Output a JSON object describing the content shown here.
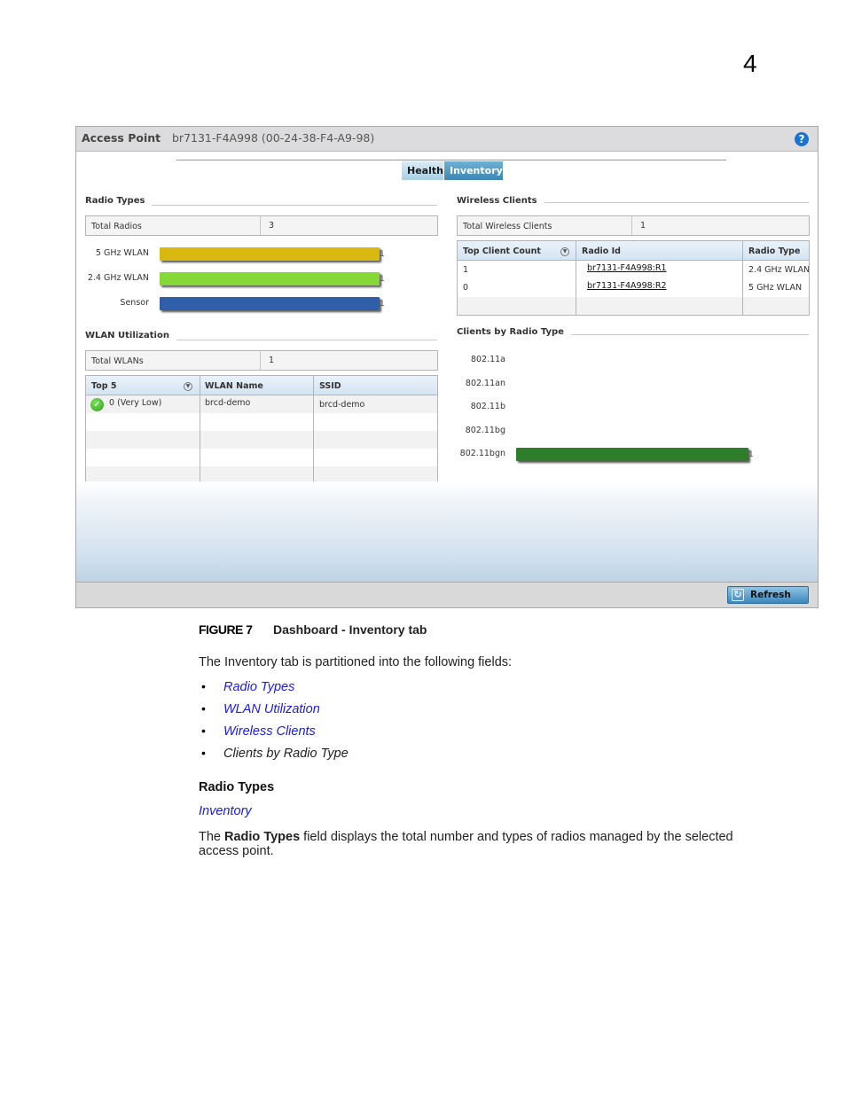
{
  "page": {
    "chapter_number": "4"
  },
  "panel": {
    "header_label": "Access Point",
    "device_name": "br7131-F4A998 (00-24-38-F4-A9-98)",
    "help_icon": "question-circle-icon",
    "tabs": [
      {
        "label": "Health",
        "active": false
      },
      {
        "label": "Inventory",
        "active": true
      }
    ],
    "radio_types": {
      "title": "Radio Types",
      "total_label": "Total Radios",
      "total_value": "3",
      "bars": [
        {
          "label": "5 GHz WLAN",
          "value": 1,
          "value_label": "1",
          "color": "#d9b90f"
        },
        {
          "label": "2.4 GHz WLAN",
          "value": 1,
          "value_label": "1",
          "color": "#86d836"
        },
        {
          "label": "Sensor",
          "value": 1,
          "value_label": "1",
          "color": "#2f5fa8"
        }
      ]
    },
    "wlan_utilization": {
      "title": "WLAN Utilization",
      "total_label": "Total WLANs",
      "total_value": "1",
      "columns": [
        "Top 5",
        "WLAN Name",
        "SSID"
      ],
      "rows": [
        {
          "top": "0 (Very Low)",
          "wlan_name": "brcd-demo",
          "ssid": "brcd-demo",
          "status_icon": "check-circle-icon"
        }
      ]
    },
    "wireless_clients": {
      "title": "Wireless Clients",
      "total_label": "Total Wireless Clients",
      "total_value": "1",
      "columns": [
        "Top Client Count",
        "Radio Id",
        "Radio Type"
      ],
      "rows": [
        {
          "count": "1",
          "radio_id": "br7131-F4A998:R1",
          "radio_type": "2.4 GHz WLAN"
        },
        {
          "count": "0",
          "radio_id": "br7131-F4A998:R2",
          "radio_type": "5 GHz WLAN"
        }
      ]
    },
    "clients_by_radio_type": {
      "title": "Clients by Radio Type",
      "bars": [
        {
          "label": "802.11a",
          "value": 0
        },
        {
          "label": "802.11an",
          "value": 0
        },
        {
          "label": "802.11b",
          "value": 0
        },
        {
          "label": "802.11bg",
          "value": 0
        },
        {
          "label": "802.11bgn",
          "value": 1,
          "value_label": "1",
          "color": "#2e7d2a"
        }
      ]
    },
    "footer": {
      "refresh_label": "Refresh"
    }
  },
  "document": {
    "figure_number": "FIGURE 7",
    "figure_title": "Dashboard - Inventory tab",
    "intro": "The Inventory tab is partitioned into the following fields:",
    "bullets": [
      {
        "text": "Radio Types",
        "link": true
      },
      {
        "text": "WLAN Utilization",
        "link": true
      },
      {
        "text": "Wireless Clients",
        "link": true
      },
      {
        "text": "Clients by Radio Type",
        "link": false
      }
    ],
    "heading": "Radio Types",
    "breadcrumb_link": "Inventory",
    "body_prefix": "The ",
    "body_bold": "Radio Types",
    "body_line1": " field displays the total number and types of radios managed by the selected",
    "body_line2": "access point."
  }
}
